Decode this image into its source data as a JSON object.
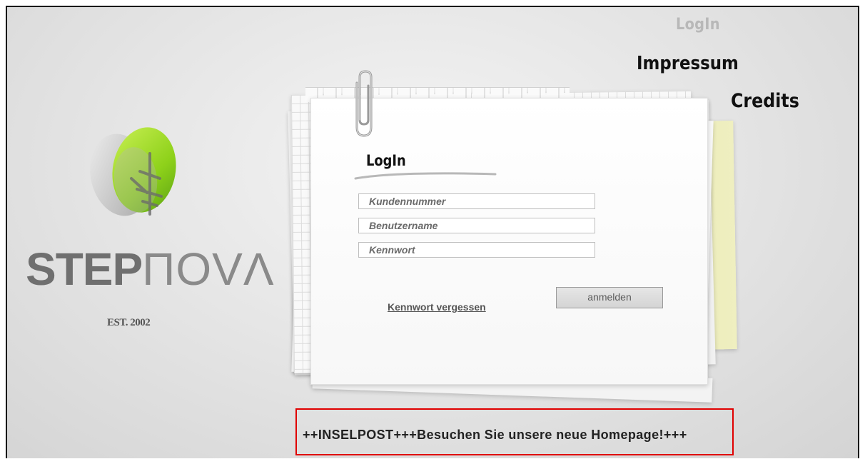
{
  "nav": {
    "login": "LogIn",
    "impressum": "Impressum",
    "credits": "Credits"
  },
  "brand": {
    "name_strong": "STEP",
    "name_light": "ΠOVΛ",
    "est": "EST. 2002",
    "logo_icon": "green-leaf-egg-icon",
    "colors": {
      "leaf": "#8ed11a",
      "brand_text": "#6f6f6f"
    }
  },
  "form": {
    "title": "LogIn",
    "customer_number": {
      "placeholder": "Kundennummer",
      "value": ""
    },
    "username": {
      "placeholder": "Benutzername",
      "value": ""
    },
    "password": {
      "placeholder": "Kennwort",
      "value": ""
    },
    "forgot_label": "Kennwort vergessen",
    "submit_label": "anmelden"
  },
  "ticker": {
    "text": "++INSELPOST+++Besuchen Sie unsere neue Homepage!+++",
    "border_color": "#e00000"
  },
  "decor": {
    "clip_icon": "paperclip-icon"
  }
}
